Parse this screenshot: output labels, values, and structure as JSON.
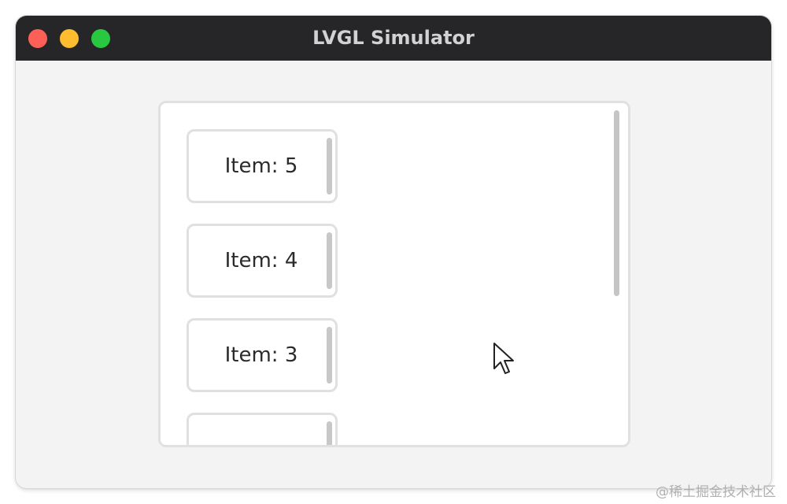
{
  "window": {
    "title": "LVGL Simulator"
  },
  "list": {
    "items": [
      {
        "label": "Item: 5"
      },
      {
        "label": "Item: 4"
      },
      {
        "label": "Item: 3"
      },
      {
        "label": ""
      }
    ]
  },
  "watermark": {
    "text": "@稀土掘金技术社区"
  },
  "colors": {
    "titlebar": "#262628",
    "close": "#fe5f57",
    "minimize": "#febc2e",
    "maximize": "#28c840",
    "panel_border": "#e1e1e1",
    "scrollbar": "#c5c5c5"
  },
  "icons": {
    "cursor": "mouse-pointer-icon"
  }
}
